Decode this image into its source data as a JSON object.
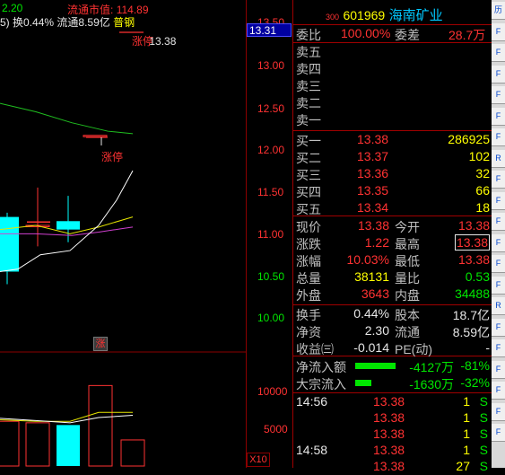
{
  "chart_header": {
    "prefix_value": "2.20",
    "turnover_text": "换0.44%",
    "float_text": "流通8.59亿",
    "ma_partial": "5)",
    "float_mv_label": "流通市值:",
    "float_mv_value": "114.89",
    "mode_label": "普钢",
    "limit_up_marker": "涨停",
    "limit_up_price": "13.38",
    "zhang_badge": "涨"
  },
  "price_axis": {
    "ticks": [
      "13.50",
      "13.31",
      "13.00",
      "12.50",
      "12.00",
      "11.50",
      "11.00",
      "10.50",
      "10.00"
    ],
    "current_highlight": "13.31"
  },
  "volume_axis": {
    "ticks": [
      "10000",
      "5000"
    ],
    "unit": "X10"
  },
  "stock": {
    "code_prefix": "300",
    "code": "601969",
    "name": "海南矿业"
  },
  "order_ratio": {
    "label1": "委比",
    "value1": "100.00%",
    "label2": "委差",
    "value2": "28.7万"
  },
  "asks": [
    {
      "label": "卖五",
      "price": "",
      "vol": ""
    },
    {
      "label": "卖四",
      "price": "",
      "vol": ""
    },
    {
      "label": "卖三",
      "price": "",
      "vol": ""
    },
    {
      "label": "卖二",
      "price": "",
      "vol": ""
    },
    {
      "label": "卖一",
      "price": "",
      "vol": ""
    }
  ],
  "bids": [
    {
      "label": "买一",
      "price": "13.38",
      "vol": "286925"
    },
    {
      "label": "买二",
      "price": "13.37",
      "vol": "102"
    },
    {
      "label": "买三",
      "price": "13.36",
      "vol": "32"
    },
    {
      "label": "买四",
      "price": "13.35",
      "vol": "66"
    },
    {
      "label": "买五",
      "price": "13.34",
      "vol": "18"
    }
  ],
  "quote": [
    {
      "l1": "现价",
      "v1": "13.38",
      "l2": "今开",
      "v2": "13.38"
    },
    {
      "l1": "涨跌",
      "v1": "1.22",
      "l2": "最高",
      "v2": "13.38"
    },
    {
      "l1": "涨幅",
      "v1": "10.03%",
      "l2": "最低",
      "v2": "13.38"
    },
    {
      "l1": "总量",
      "v1": "38131",
      "l2": "量比",
      "v2": "0.53"
    },
    {
      "l1": "外盘",
      "v1": "3643",
      "l2": "内盘",
      "v2": "34488"
    }
  ],
  "fund": [
    {
      "l1": "换手",
      "v1": "0.44%",
      "l2": "股本",
      "v2": "18.7亿"
    },
    {
      "l1": "净资",
      "v1": "2.30",
      "l2": "流通",
      "v2": "8.59亿"
    },
    {
      "l1": "收益㈢",
      "v1": "-0.014",
      "l2": "PE(动)",
      "v2": "-"
    }
  ],
  "flows": [
    {
      "label": "净流入额",
      "value": "-4127万",
      "pct": "-81%",
      "bar": 0.81
    },
    {
      "label": "大宗流入",
      "value": "-1630万",
      "pct": "-32%",
      "bar": 0.32
    }
  ],
  "ticks": [
    {
      "time": "14:56",
      "price": "13.38",
      "vol": "1",
      "flag": "S"
    },
    {
      "time": "",
      "price": "13.38",
      "vol": "1",
      "flag": "S"
    },
    {
      "time": "",
      "price": "13.38",
      "vol": "1",
      "flag": "S"
    },
    {
      "time": "14:58",
      "price": "13.38",
      "vol": "1",
      "flag": "S"
    },
    {
      "time": "",
      "price": "13.38",
      "vol": "27",
      "flag": "S"
    }
  ],
  "toolbar": [
    "历",
    "F",
    "F",
    "F",
    "F",
    "F",
    "F",
    "R",
    "F",
    "F",
    "F",
    "F",
    "F",
    "F",
    "R",
    "F",
    "F",
    "F",
    "F",
    "F",
    "F"
  ],
  "colors": {
    "up": "#ff3232",
    "down": "#00ffff",
    "label": "#c0c0c0",
    "bid_price": "#ff3232",
    "volume": "#ffff00",
    "name": "#00c8ff",
    "flow_bar": "#00e600"
  }
}
